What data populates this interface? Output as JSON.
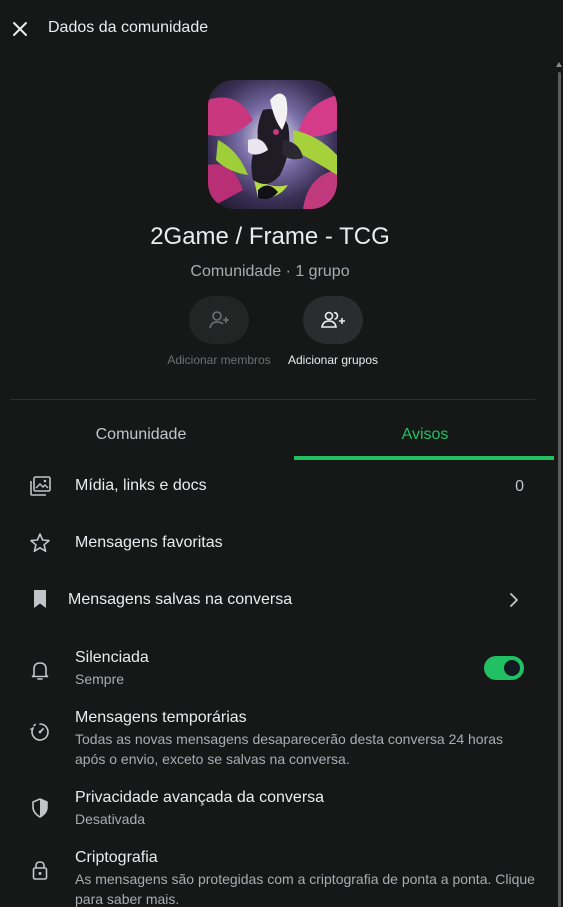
{
  "header": {
    "title": "Dados da comunidade"
  },
  "community": {
    "name": "2Game / Frame - TCG",
    "meta": "Comunidade · 1 grupo"
  },
  "actions": {
    "add_members": "Adicionar membros",
    "add_groups": "Adicionar grupos"
  },
  "tabs": {
    "community": "Comunidade",
    "announcements": "Avisos",
    "selected": "Avisos"
  },
  "rows": {
    "media": {
      "title": "Mídia, links e docs",
      "count": "0"
    },
    "starred": {
      "title": "Mensagens favoritas"
    },
    "saved": {
      "title": "Mensagens salvas na conversa"
    },
    "muted": {
      "title": "Silenciada",
      "sub": "Sempre",
      "toggle_on": true
    },
    "disappearing": {
      "title": "Mensagens temporárias",
      "sub": "Todas as novas mensagens desaparecerão desta conversa 24 horas após o envio, exceto se salvas na conversa."
    },
    "privacy": {
      "title": "Privacidade avançada da conversa",
      "sub": "Desativada"
    },
    "encryption": {
      "title": "Criptografia",
      "sub": "As mensagens são protegidas com a criptografia de ponta a ponta. Clique para saber mais."
    }
  },
  "colors": {
    "accent": "#21c063",
    "background": "#161717",
    "text_primary": "#e9edef",
    "text_secondary": "#a8adb1"
  },
  "icons": {
    "close": "close-icon",
    "add_member": "person-add-icon",
    "add_group": "group-add-icon",
    "media": "media-gallery-icon",
    "star": "star-icon",
    "bookmark": "bookmark-icon",
    "chevron": "chevron-right-icon",
    "bell": "bell-icon",
    "timer": "timer-icon",
    "shield": "shield-icon",
    "lock": "lock-icon"
  }
}
